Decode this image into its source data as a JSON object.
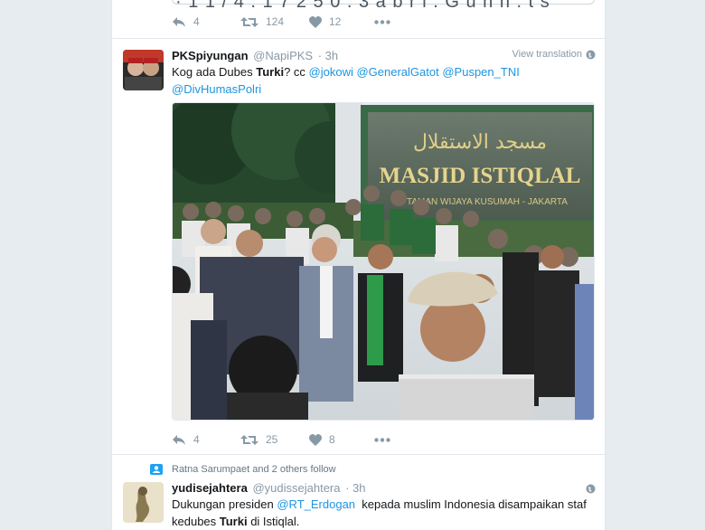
{
  "tweet_prev": {
    "cut_text": "· 1 1 / 4 . 1 7 2 5 0 . 3 a b r i . G u n n . t s",
    "reply_count": "4",
    "retweet_count": "124",
    "like_count": "12"
  },
  "tweet_main": {
    "name": "PKSpiyungan",
    "handle": "@NapiPKS",
    "time": "· 3h",
    "view_translation": "View translation",
    "text_pre": "Kog ada Dubes ",
    "text_bold": "Turki",
    "text_mid": "? cc ",
    "mentions": [
      "@jokowi",
      "@GeneralGatot",
      "@Puspen_TNI",
      "@DivHumasPolri"
    ],
    "photo": {
      "sign_arabic": "مسجد الاستقلال",
      "sign_title": "MASJID ISTIQLAL",
      "sign_sub": "JL. TAMAN WIJAYA KUSUMAH - JAKARTA"
    },
    "reply_count": "4",
    "retweet_count": "25",
    "like_count": "8"
  },
  "tweet_next": {
    "context": "Ratna Sarumpaet and 2 others follow",
    "name": "yudisejahtera",
    "handle": "@yudissejahtera",
    "time": "· 3h",
    "text_pre": "Dukungan presiden ",
    "mention": "@RT_Erdogan",
    "text_mid": "  kepada muslim Indonesia disampaikan staf",
    "text_line2_pre": "kedubes ",
    "text_bold": "Turki",
    "text_post": " di Istiqlal."
  },
  "colors": {
    "link": "#1b95e0",
    "icon": "#8899a6",
    "background": "#e6ecf0"
  }
}
